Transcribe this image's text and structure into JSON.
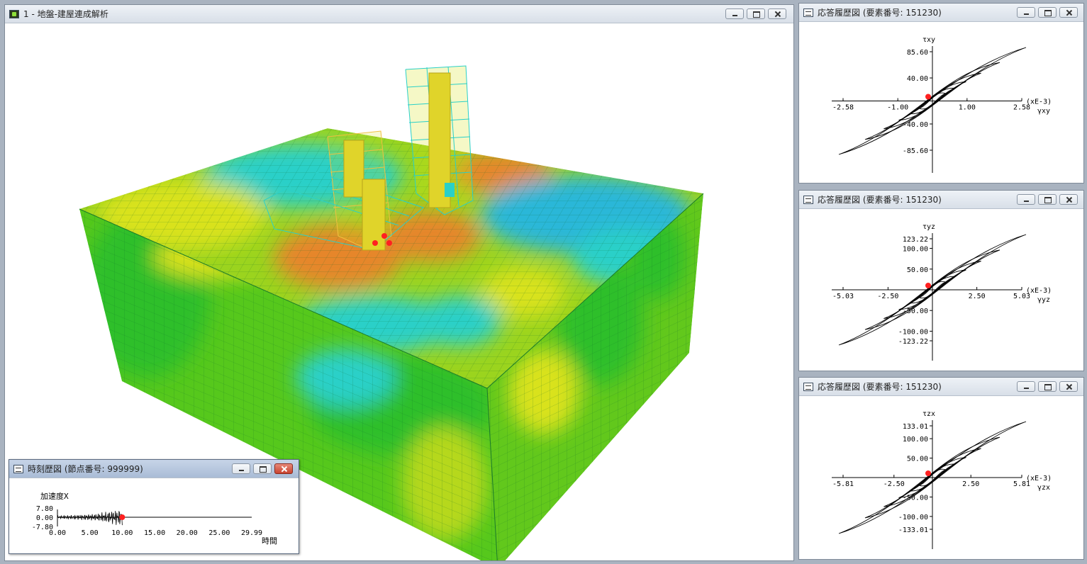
{
  "main_window": {
    "title": "1 - 地盤-建屋連成解析"
  },
  "time_history": {
    "title": "時刻歴図 (節点番号: 999999)",
    "quantity_label": "加速度X",
    "y_ticks": [
      "7.80",
      "0.00",
      "-7.80"
    ],
    "x_ticks": [
      "0.00",
      "5.00",
      "10.00",
      "15.00",
      "20.00",
      "25.00",
      "29.99"
    ],
    "x_axis_label": "時間",
    "current_marker_time": 10.0
  },
  "hysteresis_windows": [
    {
      "title": "応答履歴図 (要素番号: 151230)",
      "y_label": "τxy",
      "x_label": "γxy",
      "x_unit": "(xE-3)",
      "y_ticks": [
        "85.60",
        "40.00",
        "-40.00",
        "-85.60"
      ],
      "x_ticks": [
        "-2.58",
        "-1.00",
        "1.00",
        "2.58"
      ]
    },
    {
      "title": "応答履歴図 (要素番号: 151230)",
      "y_label": "τyz",
      "x_label": "γyz",
      "x_unit": "(xE-3)",
      "y_ticks": [
        "123.22",
        "100.00",
        "50.00",
        "-50.00",
        "-100.00",
        "-123.22"
      ],
      "x_ticks": [
        "-5.03",
        "-2.50",
        "2.50",
        "5.03"
      ]
    },
    {
      "title": "応答履歴図 (要素番号: 151230)",
      "y_label": "τzx",
      "x_label": "γzx",
      "x_unit": "(xE-3)",
      "y_ticks": [
        "133.01",
        "100.00",
        "50.00",
        "-50.00",
        "-100.00",
        "-133.01"
      ],
      "x_ticks": [
        "-5.81",
        "-2.50",
        "2.50",
        "5.81"
      ]
    }
  ],
  "colors": {
    "mesh_green": "#2fbf2a",
    "mesh_yellow": "#d9e21a",
    "mesh_cyan": "#2ad0c8",
    "mesh_orange": "#e6862a",
    "marker_red": "#ff2020"
  }
}
